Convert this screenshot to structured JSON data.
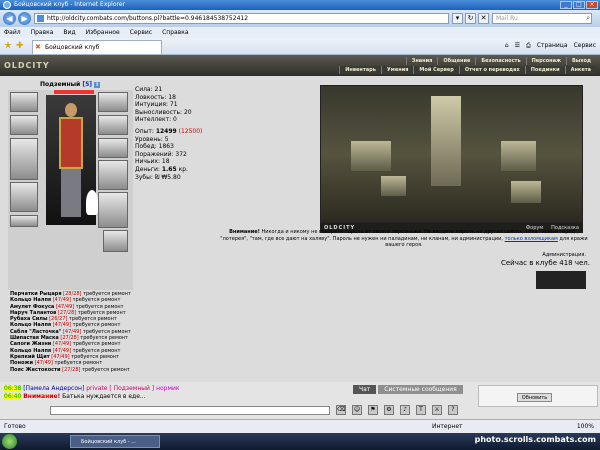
{
  "window": {
    "title": "Бойцовский клуб - Internet Explorer"
  },
  "address": {
    "url": "http://oldcity.combats.com/buttons.pl?battle=0.946184538752412",
    "search_placeholder": "Mail.Ru"
  },
  "menu": [
    "Файл",
    "Правка",
    "Вид",
    "Избранное",
    "Сервис",
    "Справка"
  ],
  "tab": {
    "label": "Бойцовский клуб"
  },
  "fav_tools": {
    "page": "Страница",
    "service": "Сервис"
  },
  "game": {
    "logo": "OLDCITY",
    "nav_top": [
      "Знания",
      "Общение",
      "Безопасность",
      "Персонаж",
      "Выход"
    ],
    "nav_bottom": [
      "Инвентарь",
      "Умения",
      "Мой Сервер",
      "Отчет о переводах",
      "Поединки",
      "Анкета"
    ],
    "character": {
      "name": "Подземный",
      "level": "[5]"
    },
    "stats": {
      "strength": "Сила: 21",
      "agility": "Ловкость: 18",
      "intuition": "Интуиция: 71",
      "stamina": "Выносливость: 20",
      "intellect": "Интеллект: 0",
      "exp_label": "Опыт:",
      "exp_value": "12499",
      "exp_next": "(12500)",
      "level": "Уровень: 5",
      "wins": "Побед: 1863",
      "losses": "Поражений: 372",
      "draws": "Ничьих: 18",
      "money_label": "Деньги:",
      "money_value": "1.65",
      "money_unit": "кр.",
      "teeth": "Зубы: ₪ ₩5.80"
    },
    "items": [
      {
        "name": "Перчатки Рыцаря",
        "dur": "[28/28]",
        "note": "требуется ремонт"
      },
      {
        "name": "Кольцо Налпя",
        "dur": "[47/49]",
        "note": "требуется ремонт"
      },
      {
        "name": "Амулет Фокуса",
        "dur": "[47/49]",
        "note": "требуется ремонт"
      },
      {
        "name": "Наруч Талантов",
        "dur": "[27/28]",
        "note": "требуется ремонт"
      },
      {
        "name": "Рубаха Силы",
        "dur": "[26/27]",
        "note": "требуется ремонт"
      },
      {
        "name": "Кольцо Налпя",
        "dur": "[47/49]",
        "note": "требуется ремонт"
      },
      {
        "name": "Сабля \"Ласточка\"",
        "dur": "[47/49]",
        "note": "требуется ремонт"
      },
      {
        "name": "Шипастая Маска",
        "dur": "[27/28]",
        "note": "требуется ремонт"
      },
      {
        "name": "Сапоги Жизни",
        "dur": "[47/49]",
        "note": "требуется ремонт"
      },
      {
        "name": "Кольцо Налпя",
        "dur": "[47/49]",
        "note": "требуется ремонт"
      },
      {
        "name": "Крепкий Щит",
        "dur": "[47/49]",
        "note": "требуется ремонт"
      },
      {
        "name": "Поножи",
        "dur": "[47/49]",
        "note": "требуется ремонт"
      },
      {
        "name": "Пояс Жестокости",
        "dur": "[27/28]",
        "note": "требуется ремонт"
      }
    ],
    "scene": {
      "logo": "OLDCITY",
      "forum": "Форум",
      "hint": "Подсказка"
    },
    "warning": {
      "bold": "Внимание!",
      "text": " Никогда и никому не говорите пароль от своего персонажа. Не вводите пароль на других сайтах, типа \"новый город\", \"лотерея\", \"там, где все дают на халяву\". Пароль не нужен ни паладинам, ни кланам, ни администрации,",
      "link": "только взломщикам",
      "tail": " для кражи вашего героя.",
      "admin": "Администрация."
    },
    "online": "Сейчас в клубе 418 чел."
  },
  "chat": {
    "messages": [
      {
        "time": "06:38",
        "nick": "[Памела Андерсон]",
        "priv": "private [ Подземный ]",
        "text": "нормик"
      },
      {
        "time": "06:40",
        "warn": "Внимание!",
        "text": "Батька нуждается в еде..."
      }
    ],
    "tabs": [
      "Чат",
      "Системные сообщения"
    ],
    "refresh": "Обновить"
  },
  "status": {
    "left": "Готово",
    "zone": "Интернет",
    "zoom": "100%"
  },
  "taskbar": {
    "item": "Бойцовский клуб - ...",
    "watermark": "photo.scrolls.combats.com"
  }
}
